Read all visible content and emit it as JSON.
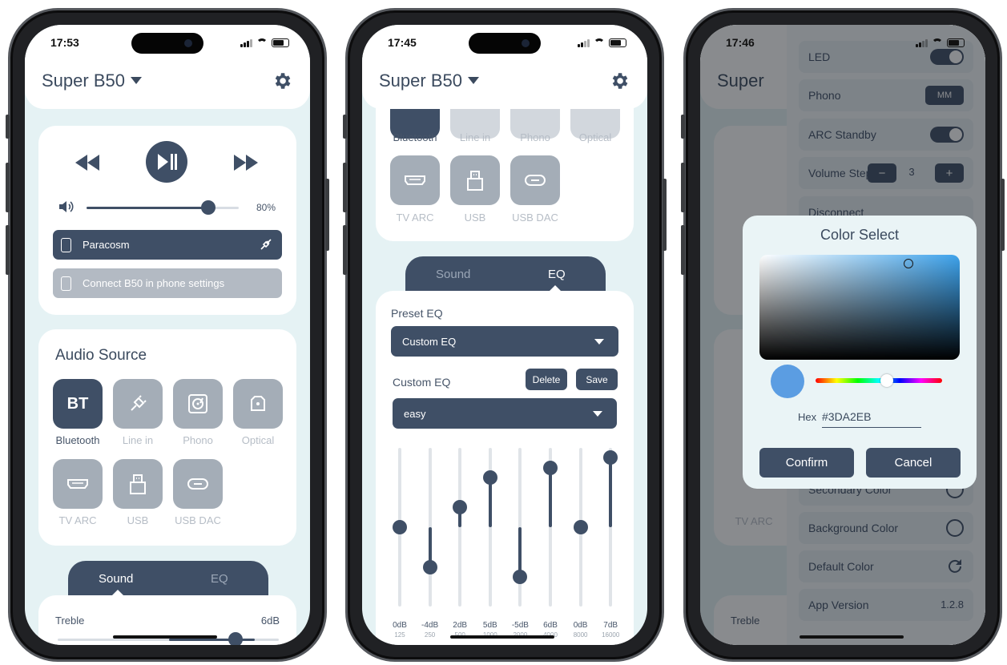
{
  "phone1": {
    "time": "17:53",
    "device_name": "Super B50",
    "volume_percent": 80,
    "volume_label": "80%",
    "connected_device": "Paracosm",
    "connect_hint": "Connect B50 in phone settings",
    "audio_source_title": "Audio Source",
    "sources": [
      {
        "label": "Bluetooth",
        "icon": "bt-text-icon",
        "badge": "BT",
        "active": true
      },
      {
        "label": "Line in",
        "icon": "line-in-icon",
        "active": false
      },
      {
        "label": "Phono",
        "icon": "phono-icon",
        "active": false
      },
      {
        "label": "Optical",
        "icon": "optical-icon",
        "active": false
      },
      {
        "label": "TV ARC",
        "icon": "hdmi-icon",
        "active": false
      },
      {
        "label": "USB",
        "icon": "usb-icon",
        "active": false
      },
      {
        "label": "USB DAC",
        "icon": "usb-c-icon",
        "active": false
      }
    ],
    "tabs": [
      "Sound",
      "EQ"
    ],
    "active_tab": "Sound",
    "treble_label": "Treble",
    "treble_value": "6dB",
    "treble_level": 0.8
  },
  "phone2": {
    "time": "17:45",
    "device_name": "Super B50",
    "sources_row1": [
      "Bluetooth",
      "Line in",
      "Phono",
      "Optical"
    ],
    "sources_row2": [
      "TV ARC",
      "USB",
      "USB DAC"
    ],
    "tabs": [
      "Sound",
      "EQ"
    ],
    "active_tab": "EQ",
    "preset_label": "Preset EQ",
    "preset_value": "Custom EQ",
    "custom_label": "Custom EQ",
    "delete_label": "Delete",
    "save_label": "Save",
    "custom_value": "easy",
    "bands": [
      {
        "db": "0dB",
        "hz": "125",
        "value": 0
      },
      {
        "db": "-4dB",
        "hz": "250",
        "value": -4
      },
      {
        "db": "2dB",
        "hz": "500",
        "value": 2
      },
      {
        "db": "5dB",
        "hz": "1000",
        "value": 5
      },
      {
        "db": "-5dB",
        "hz": "2000",
        "value": -5
      },
      {
        "db": "6dB",
        "hz": "4000",
        "value": 6
      },
      {
        "db": "0dB",
        "hz": "8000",
        "value": 0
      },
      {
        "db": "7dB",
        "hz": "16000",
        "value": 7
      }
    ]
  },
  "phone3": {
    "time": "17:46",
    "settings": [
      {
        "label": "LED",
        "control": "toggle"
      },
      {
        "label": "Phono",
        "control": "badge",
        "badge": "MM"
      },
      {
        "label": "ARC Standby",
        "control": "toggle"
      },
      {
        "label": "Volume Step",
        "control": "stepper",
        "value": "3",
        "minus": "−",
        "plus": "+"
      },
      {
        "label": "Disconnect",
        "control": "icon"
      },
      {
        "label": "Secondary Color",
        "control": "circle"
      },
      {
        "label": "Background Color",
        "control": "circle"
      },
      {
        "label": "Default Color",
        "control": "reset"
      },
      {
        "label": "App Version",
        "control": "text",
        "value": "1.2.8"
      }
    ],
    "bg_partial": {
      "title": "Super",
      "treble": "Treble",
      "tv_arc": "TV ARC"
    },
    "dialog": {
      "title": "Color Select",
      "hex_label": "Hex",
      "hex_value": "#3DA2EB",
      "swatch_color": "#5b9de2",
      "confirm": "Confirm",
      "cancel": "Cancel"
    }
  },
  "colors": {
    "primary": "#3f4f66",
    "inactive": "#a4adb7",
    "screen_bg": "#e5f2f4"
  }
}
